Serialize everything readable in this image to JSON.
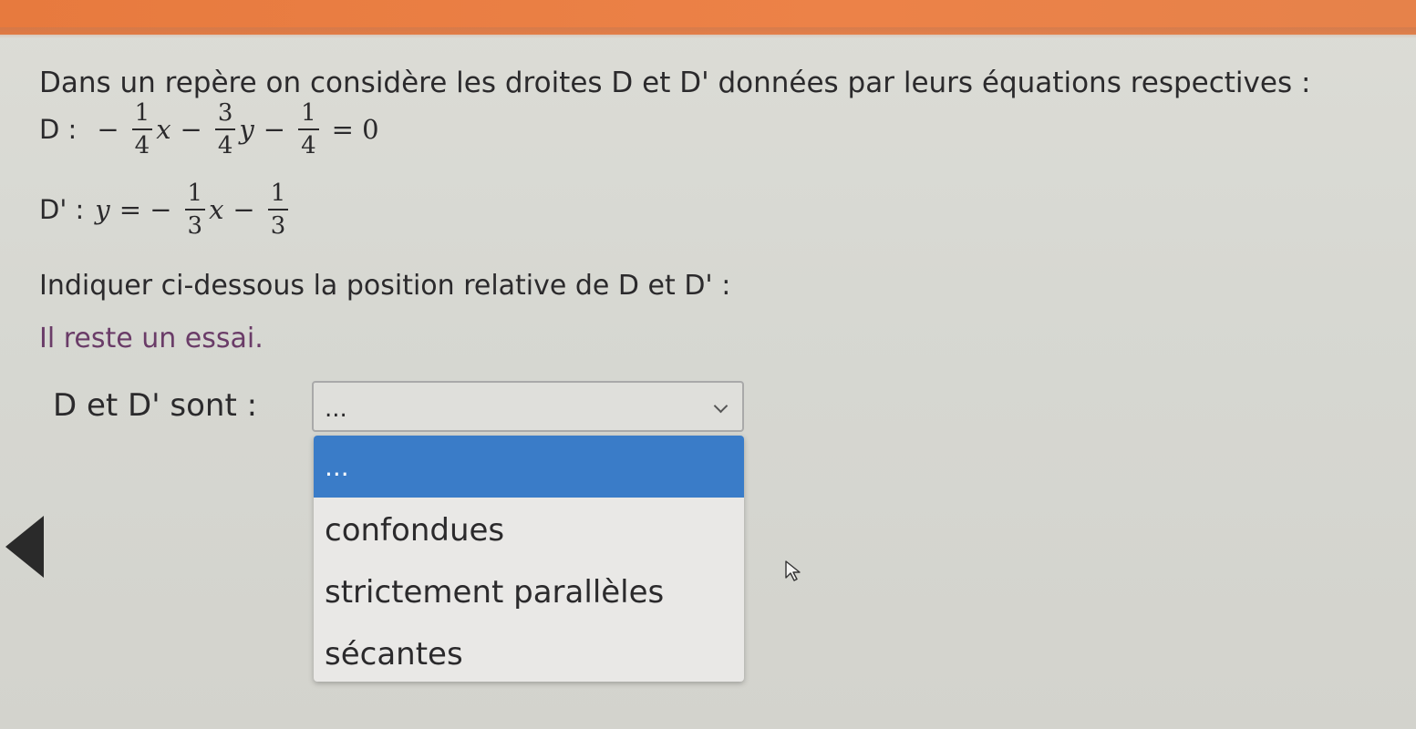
{
  "intro": "Dans un repère on considère les droites D et D' données par leurs équations respectives :",
  "equation_d": {
    "label": "D :",
    "minus1": "−",
    "f1_num": "1",
    "f1_den": "4",
    "var1": "x",
    "minus2": "−",
    "f2_num": "3",
    "f2_den": "4",
    "var2": "y",
    "minus3": "−",
    "f3_num": "1",
    "f3_den": "4",
    "equals": "= 0"
  },
  "equation_dp": {
    "label": "D' :",
    "lhs": "y",
    "equals": "= −",
    "f1_num": "1",
    "f1_den": "3",
    "var1": "x",
    "minus": "−",
    "f2_num": "1",
    "f2_den": "3"
  },
  "question": "Indiquer ci-dessous la position relative de D et D' :",
  "attempts_remaining": "Il reste un essai.",
  "answer": {
    "label": "D et D' sont :",
    "selected_value": "...",
    "options": [
      "...",
      "confondues",
      "strictement parallèles",
      "sécantes"
    ]
  },
  "colors": {
    "top_bar": "#e77a3e",
    "highlight": "#3a7cc8",
    "attempts_text": "#6a3c68"
  },
  "icons": {
    "dropdown": "chevron-down-icon",
    "back": "left-triangle-icon",
    "pointer": "mouse-cursor-icon"
  }
}
